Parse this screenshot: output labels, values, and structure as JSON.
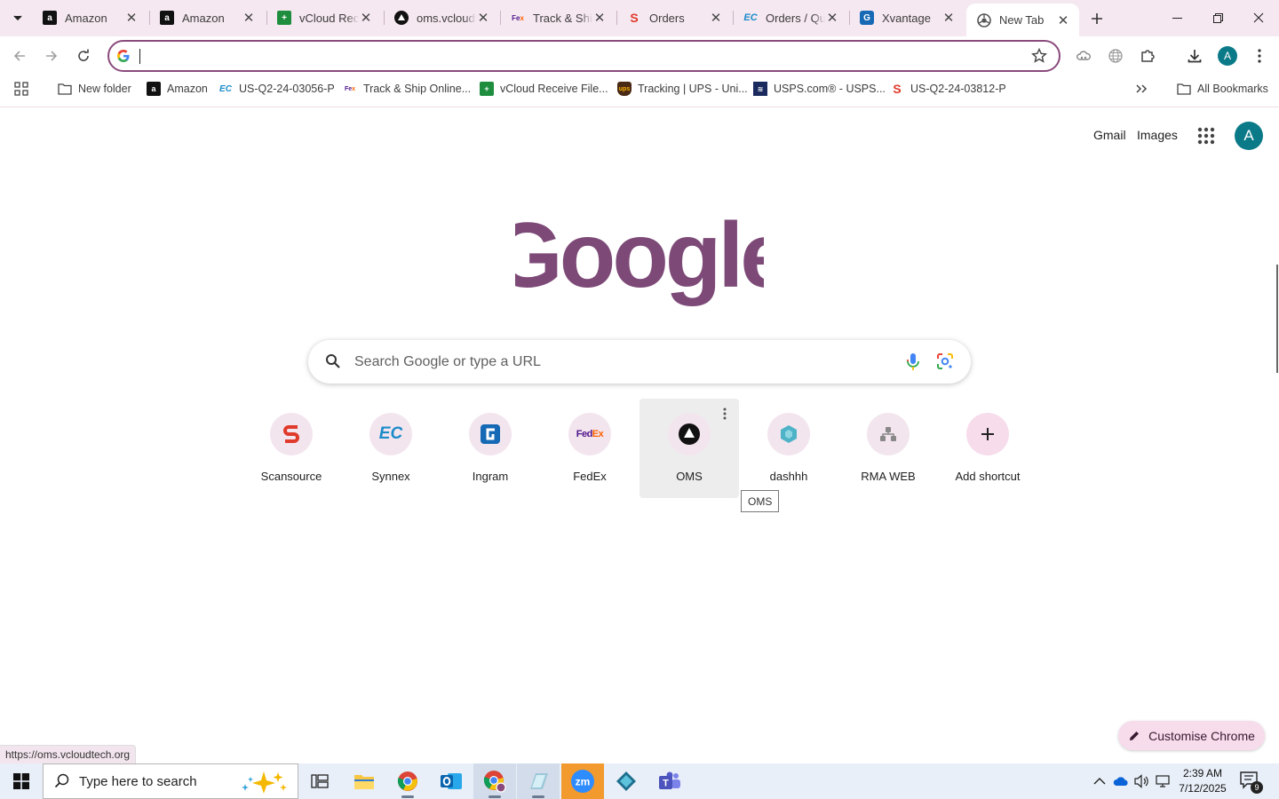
{
  "browser": {
    "tabs": [
      {
        "title": "Amazon",
        "favicon": "amazon-icon"
      },
      {
        "title": "Amazon",
        "favicon": "amazon-icon"
      },
      {
        "title": "vCloud Receive File",
        "favicon": "sheets-icon"
      },
      {
        "title": "oms.vcloudtech.org",
        "favicon": "oms-icon"
      },
      {
        "title": "Track & Ship Online",
        "favicon": "fedex-icon"
      },
      {
        "title": "Orders",
        "favicon": "scansource-icon"
      },
      {
        "title": "Orders / Quotes",
        "favicon": "ec-icon"
      },
      {
        "title": "Xvantage",
        "favicon": "ingram-icon"
      },
      {
        "title": "New Tab",
        "favicon": "chrome-icon",
        "active": true
      }
    ],
    "omnibox": {
      "value": "",
      "placeholder": ""
    },
    "profile_initial": "A",
    "bookmarks": [
      {
        "label": "New folder",
        "icon": "folder-icon"
      },
      {
        "label": "Amazon",
        "icon": "amazon-icon"
      },
      {
        "label": "US-Q2-24-03056-P",
        "icon": "ec-icon"
      },
      {
        "label": "Track & Ship Online...",
        "icon": "fedex-icon"
      },
      {
        "label": "vCloud Receive File...",
        "icon": "sheets-icon"
      },
      {
        "label": "Tracking | UPS - Uni...",
        "icon": "ups-icon"
      },
      {
        "label": "USPS.com® - USPS...",
        "icon": "usps-icon"
      },
      {
        "label": "US-Q2-24-03812-P",
        "icon": "scansource-icon"
      }
    ],
    "all_bookmarks_label": "All Bookmarks"
  },
  "ntp": {
    "gmail_label": "Gmail",
    "images_label": "Images",
    "avatar_initial": "A",
    "logo_text": "Google",
    "search_placeholder": "Search Google or type a URL",
    "shortcuts": [
      {
        "label": "Scansource",
        "icon": "scansource-icon"
      },
      {
        "label": "Synnex",
        "icon": "ec-icon"
      },
      {
        "label": "Ingram",
        "icon": "ingram-icon"
      },
      {
        "label": "FedEx",
        "icon": "fedex-icon"
      },
      {
        "label": "OMS",
        "icon": "oms-icon"
      },
      {
        "label": "dashhh",
        "icon": "dash-icon"
      },
      {
        "label": "RMA WEB",
        "icon": "rma-icon"
      },
      {
        "label": "Add shortcut",
        "icon": "plus-icon"
      }
    ],
    "tooltip": "OMS",
    "customise_label": "Customise Chrome",
    "status_url": "https://oms.vcloudtech.org"
  },
  "taskbar": {
    "search_placeholder": "Type here to search",
    "time": "2:39 AM",
    "date": "7/12/2025",
    "notification_count": "9"
  },
  "colors": {
    "accent": "#8a4a7c",
    "logo": "#7d4a78",
    "tab_strip": "#f6e8f1",
    "chip": "#f7dcec"
  }
}
